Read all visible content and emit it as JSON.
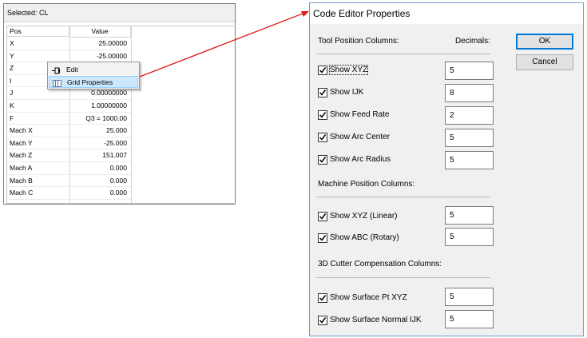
{
  "grid_panel": {
    "header": "Selected: CL",
    "columns": {
      "pos": "Pos",
      "value": "Value"
    },
    "rows": [
      {
        "pos": "X",
        "value": "25.00000"
      },
      {
        "pos": "Y",
        "value": "-25.00000"
      },
      {
        "pos": "Z",
        "value": ""
      },
      {
        "pos": "I",
        "value": ""
      },
      {
        "pos": "J",
        "value": "0.00000000"
      },
      {
        "pos": "K",
        "value": "1.00000000"
      },
      {
        "pos": "F",
        "value": "Q3 = 1000.00"
      },
      {
        "pos": "Mach X",
        "value": "25.000"
      },
      {
        "pos": "Mach Y",
        "value": "-25.000"
      },
      {
        "pos": "Mach Z",
        "value": "151.007"
      },
      {
        "pos": "Mach A",
        "value": "0.000"
      },
      {
        "pos": "Mach B",
        "value": "0.000"
      },
      {
        "pos": "Mach C",
        "value": "0.000"
      }
    ]
  },
  "context_menu": {
    "edit": "Edit",
    "grid_properties": "Grid Properties"
  },
  "arrow_color": "#e31b1b",
  "dialog": {
    "title": "Code Editor Properties",
    "tool_position_label": "Tool Position Columns:",
    "decimals_label": "Decimals:",
    "machine_position_label": "Machine Position Columns:",
    "cutter_comp_label": "3D Cutter Compensation Columns:",
    "ok_label": "OK",
    "cancel_label": "Cancel",
    "tool_items": [
      {
        "label": "Show XYZ",
        "checked": true,
        "decimals": "5"
      },
      {
        "label": "Show IJK",
        "checked": true,
        "decimals": "8"
      },
      {
        "label": "Show Feed Rate",
        "checked": true,
        "decimals": "2"
      },
      {
        "label": "Show Arc Center",
        "checked": true,
        "decimals": "5"
      },
      {
        "label": "Show Arc Radius",
        "checked": true,
        "decimals": "5"
      }
    ],
    "machine_items": [
      {
        "label": "Show XYZ (Linear)",
        "checked": true,
        "decimals": "5"
      },
      {
        "label": "Show ABC (Rotary)",
        "checked": true,
        "decimals": "5"
      }
    ],
    "cutter_items": [
      {
        "label": "Show Surface Pt XYZ",
        "checked": true,
        "decimals": "5"
      },
      {
        "label": "Show Surface Normal IJK",
        "checked": true,
        "decimals": "5"
      }
    ]
  }
}
